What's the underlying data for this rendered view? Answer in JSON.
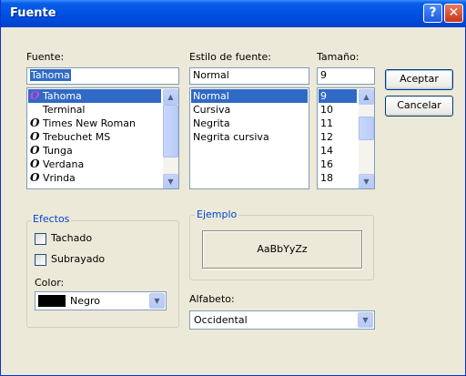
{
  "title": "Fuente",
  "titlebar": {
    "help_glyph": "?",
    "close_glyph": "✕"
  },
  "font": {
    "label": "Fuente:",
    "value": "Tahoma",
    "items": [
      {
        "name": "Tahoma",
        "icon": "opentype-font-icon",
        "glyph": "O"
      },
      {
        "name": "Terminal",
        "icon": "",
        "glyph": ""
      },
      {
        "name": "Times New Roman",
        "icon": "opentype-font-icon",
        "glyph": "O"
      },
      {
        "name": "Trebuchet MS",
        "icon": "opentype-font-icon",
        "glyph": "O"
      },
      {
        "name": "Tunga",
        "icon": "opentype-font-icon",
        "glyph": "O"
      },
      {
        "name": "Verdana",
        "icon": "opentype-font-icon",
        "glyph": "O"
      },
      {
        "name": "Vrinda",
        "icon": "opentype-font-icon",
        "glyph": "O"
      }
    ],
    "selected_index": 0
  },
  "style": {
    "label": "Estilo de fuente:",
    "value": "Normal",
    "items": [
      "Normal",
      "Cursiva",
      "Negrita",
      "Negrita cursiva"
    ],
    "selected_index": 0
  },
  "size": {
    "label": "Tamaño:",
    "value": "9",
    "items": [
      "9",
      "10",
      "11",
      "12",
      "14",
      "16",
      "18"
    ],
    "selected_index": 0
  },
  "buttons": {
    "ok": "Aceptar",
    "cancel": "Cancelar"
  },
  "effects": {
    "title": "Efectos",
    "strikeout": "Tachado",
    "underline": "Subrayado",
    "strikeout_checked": false,
    "underline_checked": false,
    "color_label": "Color:",
    "color_value": "Negro",
    "color_hex": "#000000"
  },
  "sample": {
    "title": "Ejemplo",
    "text": "AaBbYyZz"
  },
  "script": {
    "label": "Alfabeto:",
    "value": "Occidental"
  },
  "colors": {
    "selection": "#316AC5",
    "titlebar": "#0053E3",
    "group_title": "#0046D5",
    "dialog_bg": "#ECE9D8"
  }
}
